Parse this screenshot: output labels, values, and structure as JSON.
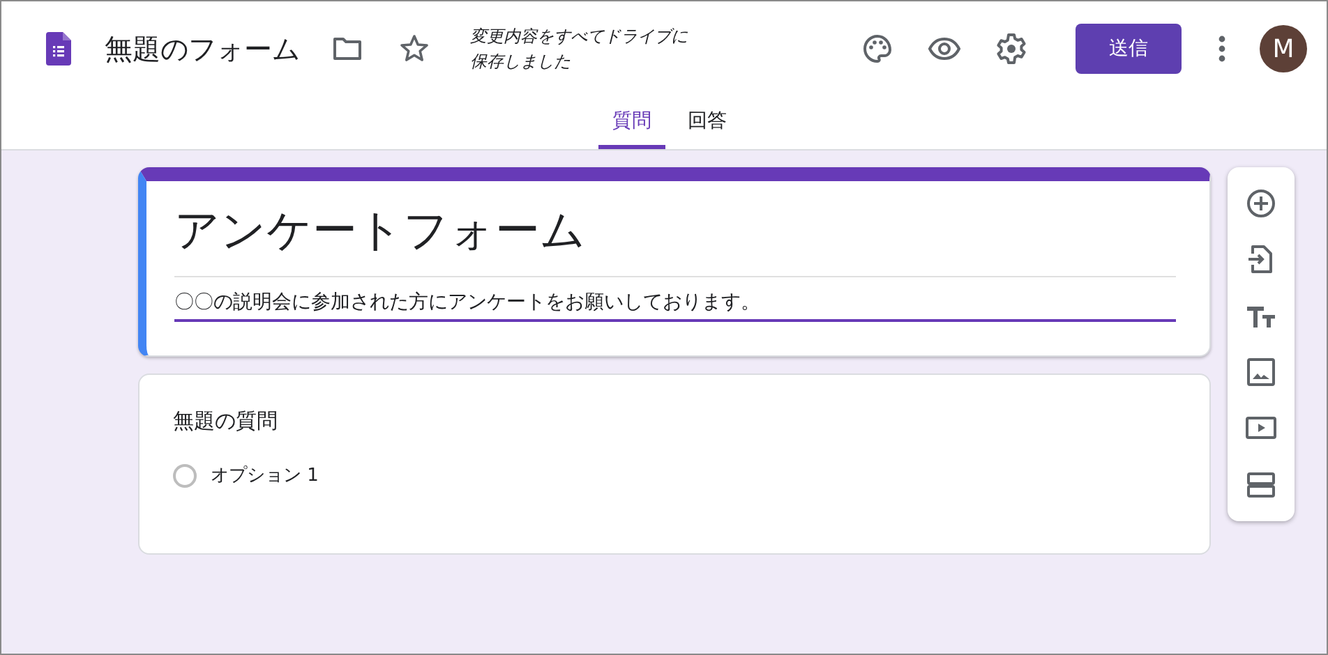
{
  "header": {
    "title": "無題のフォーム",
    "save_status": "変更内容をすべてドライブに保存しました",
    "send_button": "送信",
    "avatar": "M"
  },
  "tabs": [
    {
      "label": "質問",
      "selected": true
    },
    {
      "label": "回答",
      "selected": false
    }
  ],
  "form_header": {
    "title": "アンケートフォーム",
    "description": "〇〇の説明会に参加された方にアンケートをお願いしております。"
  },
  "questions": [
    {
      "title": "無題の質問",
      "options": [
        {
          "label": "オプション 1",
          "checked": false
        }
      ]
    }
  ]
}
